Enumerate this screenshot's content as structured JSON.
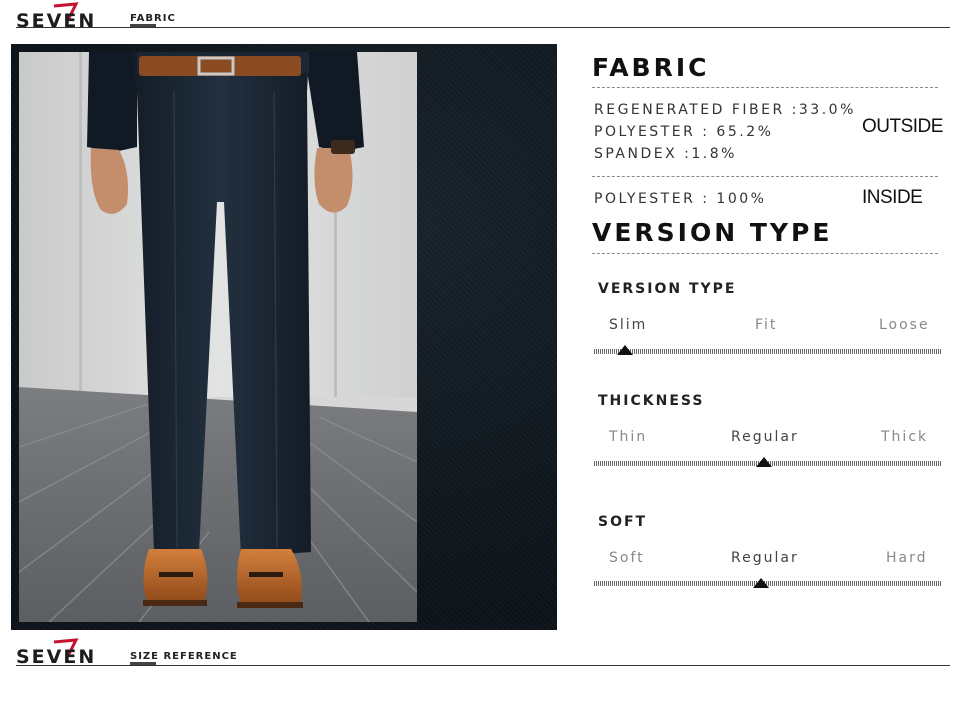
{
  "header": {
    "brand": "SEVEN",
    "section_label": "FABRIC"
  },
  "footer": {
    "brand": "SEVEN",
    "section_label": "SIZE REFERENCE"
  },
  "fabric": {
    "title": "FABRIC",
    "outside_lines": [
      "REGENERATED FIBER :33.0%",
      "POLYESTER  : 65.2%",
      "SPANDEX :1.8%"
    ],
    "outside_tag": "OUTSIDE",
    "inside_line": "POLYESTER  : 100%",
    "inside_tag": "INSIDE"
  },
  "version": {
    "title": "VERSION TYPE",
    "scales": [
      {
        "name": "VERSION TYPE",
        "options": [
          "Slim",
          "Fit",
          "Loose"
        ],
        "selected": 0
      },
      {
        "name": "THICKNESS",
        "options": [
          "Thin",
          "Regular",
          "Thick"
        ],
        "selected": 1
      },
      {
        "name": "SOFT",
        "options": [
          "Soft",
          "Regular",
          "Hard"
        ],
        "selected": 1
      }
    ]
  },
  "colors": {
    "brand_accent": "#c8102e",
    "pants": "#1a2533",
    "belt": "#8a4a22",
    "shoes": "#b5642a"
  }
}
